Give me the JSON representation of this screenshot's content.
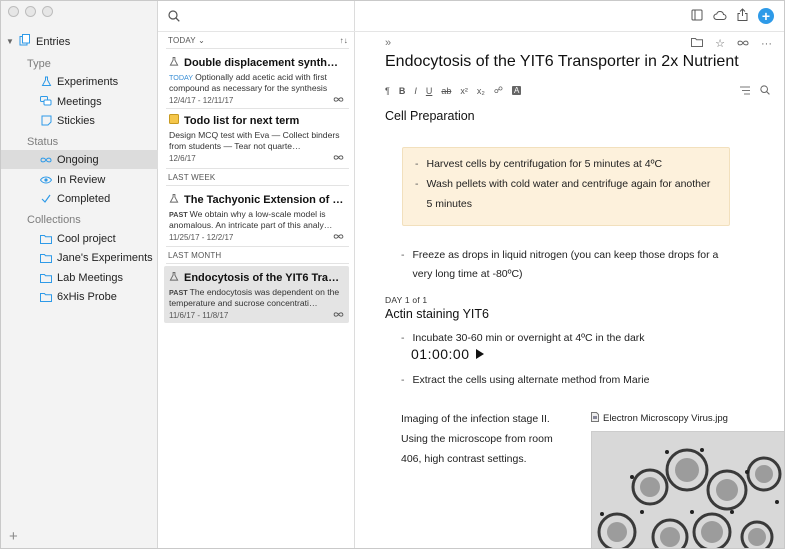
{
  "sidebar": {
    "root_label": "Entries",
    "sections": [
      {
        "title": "Type",
        "items": [
          {
            "label": "Experiments",
            "icon": "flask-icon"
          },
          {
            "label": "Meetings",
            "icon": "chat-bubbles-icon"
          },
          {
            "label": "Stickies",
            "icon": "note-icon"
          }
        ]
      },
      {
        "title": "Status",
        "items": [
          {
            "label": "Ongoing",
            "icon": "infinity-icon",
            "selected": true
          },
          {
            "label": "In Review",
            "icon": "eye-icon"
          },
          {
            "label": "Completed",
            "icon": "checkmark-icon"
          }
        ]
      },
      {
        "title": "Collections",
        "items": [
          {
            "label": "Cool project",
            "icon": "folder-icon"
          },
          {
            "label": "Jane's Experiments",
            "icon": "folder-icon"
          },
          {
            "label": "Lab Meetings",
            "icon": "folder-icon"
          },
          {
            "label": "6xHis Probe",
            "icon": "folder-icon"
          }
        ]
      }
    ],
    "add_label": "+"
  },
  "list": {
    "sort_label": "TODAY",
    "sort_arrow": "↑↓",
    "groups": {
      "last_week": "LAST WEEK",
      "last_month": "LAST MONTH"
    },
    "entries": [
      {
        "title": "Double displacement synthesi…",
        "tag": "TODAY",
        "body": "Optionally add acetic acid with first compound as necessary for the synthesis",
        "date": "12/4/17 - 12/11/17",
        "icon": "flask-icon"
      },
      {
        "title": "Todo list for next term",
        "tag": "",
        "body": "Design MCQ test with Eva — Collect binders from students — Tear not quarte…",
        "date": "12/6/17",
        "icon": "sticky-note-icon"
      },
      {
        "title": "The Tachyonic Extension of To…",
        "tag": "PAST",
        "body": "We obtain why a low-scale model is anomalous. An intricate part of this analy…",
        "date": "11/25/17 - 12/2/17",
        "icon": "flask-icon"
      },
      {
        "title": "Endocytosis of the YIT6 Trans…",
        "tag": "PAST",
        "body": "The endocytosis was dependent on the temperature and sucrose concentrati…",
        "date": "11/6/17 - 11/8/17",
        "icon": "flask-icon",
        "selected": true
      }
    ]
  },
  "editor": {
    "title": "Endocytosis of the YIT6 Transporter in 2x Nutrient",
    "format": {
      "paragraph": "¶",
      "bold": "B",
      "italic": "I",
      "underline": "U",
      "strike": "ab",
      "superscript": "x²",
      "subscript": "x₂",
      "link": "☍",
      "highlight": "A"
    },
    "section1": "Cell Preparation",
    "callout_items": [
      "Harvest cells by centrifugation for 5 minutes at 4ºC",
      "Wash pellets with cold water and centrifuge again for another 5 minutes"
    ],
    "freeze_item": "Freeze as drops in liquid nitrogen (you can keep those drops for a very long time at -80ºC)",
    "day_label": "DAY 1 of 1",
    "section2": "Actin staining YIT6",
    "incubate_item": "Incubate 30-60 min or overnight at 4ºC in the dark",
    "timer": "01:00:00",
    "extract_item": "Extract the cells using alternate method from Marie",
    "imaging_text": "Imaging of the infection stage II. Using the microscope from room 406, high contrast settings.",
    "attachment_name": "Electron Microscopy Virus.jpg",
    "expand_glyph": "»",
    "more_glyph": "···"
  },
  "colors": {
    "accent": "#2e9ae8",
    "callout_bg": "#fdf1dc",
    "sidebar_bg": "#f3f3f3",
    "selected": "#dcdcdc"
  }
}
